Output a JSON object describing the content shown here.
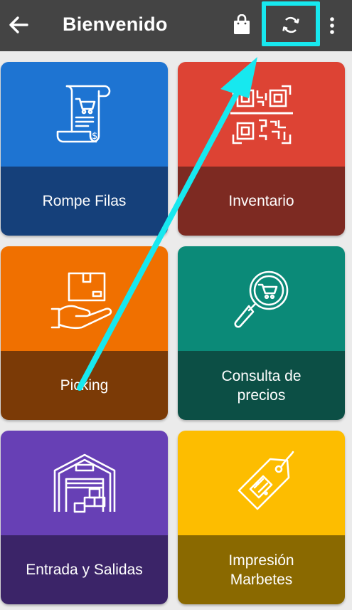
{
  "header": {
    "title": "Bienvenido",
    "back_icon": "arrow-left-icon",
    "bag_icon": "shopping-bag-icon",
    "sync_icon": "sync-icon",
    "more_icon": "more-vert-icon",
    "highlight_color": "#17e8ef"
  },
  "tiles": [
    {
      "label": "Rompe Filas",
      "icon": "receipt-cart-icon",
      "top_color": "#1e74d2",
      "bottom_color": "#15407a"
    },
    {
      "label": "Inventario",
      "icon": "qr-code-icon",
      "top_color": "#dd4334",
      "bottom_color": "#7d2a22"
    },
    {
      "label": "Picking",
      "icon": "hand-box-icon",
      "top_color": "#f07000",
      "bottom_color": "#7b3a06"
    },
    {
      "label": "Consulta de\nprecios",
      "icon": "magnifier-cart-icon",
      "top_color": "#0b8a78",
      "bottom_color": "#0c4f45"
    },
    {
      "label": "Entrada y Salidas",
      "icon": "warehouse-icon",
      "top_color": "#6740b5",
      "bottom_color": "#3b2468"
    },
    {
      "label": "Impresión\nMarbetes",
      "icon": "price-tag-icon",
      "top_color": "#fdbd00",
      "bottom_color": "#8a6900"
    }
  ],
  "annotation": {
    "arrow_color": "#17e8ef"
  }
}
